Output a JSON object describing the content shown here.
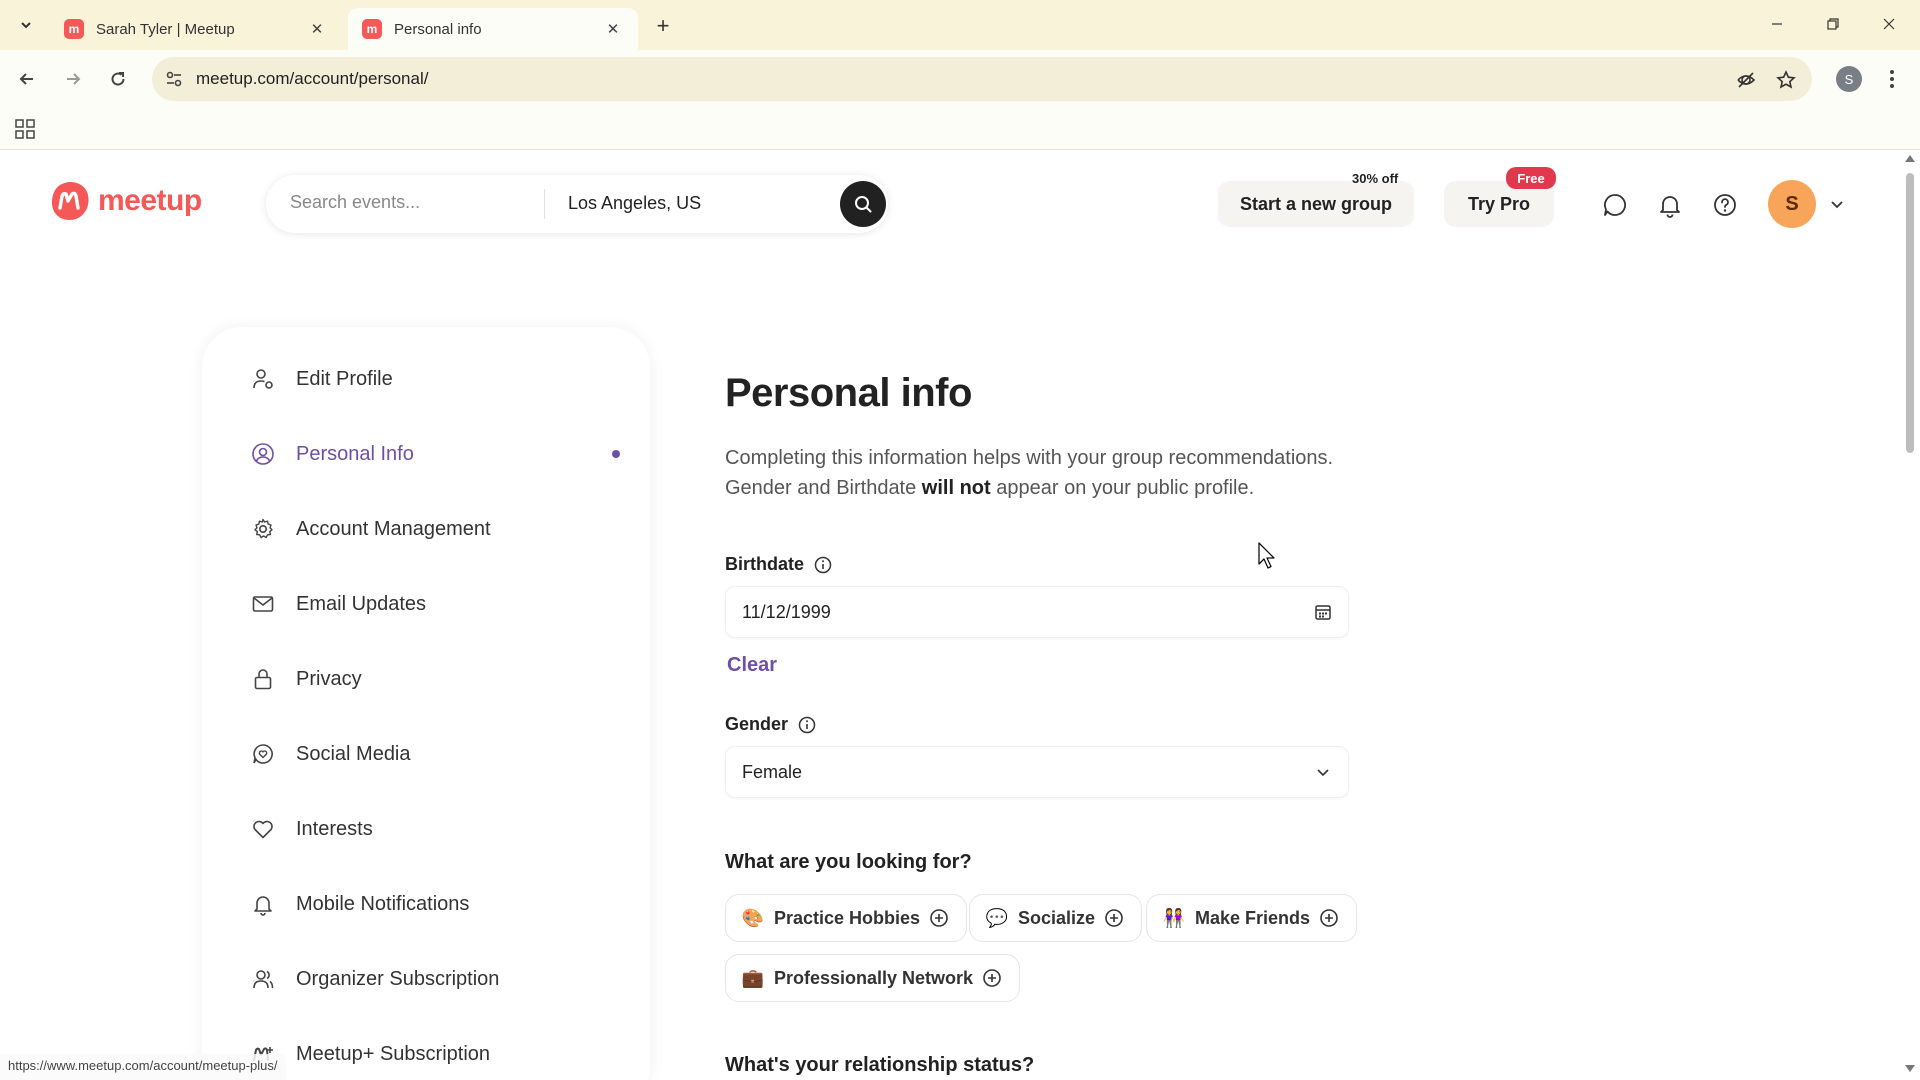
{
  "browser": {
    "tabs": [
      {
        "title": "Sarah Tyler | Meetup",
        "favicon": "m"
      },
      {
        "title": "Personal info",
        "favicon": "m"
      }
    ],
    "url": "meetup.com/account/personal/",
    "profile_initial": "S"
  },
  "header": {
    "logo_text": "meetup",
    "search_placeholder": "Search events...",
    "location": "Los Angeles, US",
    "start_group_label": "Start a new group",
    "start_group_badge": "30% off",
    "try_pro_label": "Try Pro",
    "try_pro_badge": "Free",
    "avatar_initial": "S"
  },
  "sidebar": {
    "items": [
      {
        "label": "Edit Profile",
        "icon": "user-edit-icon"
      },
      {
        "label": "Personal Info",
        "icon": "user-circle-icon",
        "active": true
      },
      {
        "label": "Account Management",
        "icon": "gear-icon"
      },
      {
        "label": "Email Updates",
        "icon": "mail-icon"
      },
      {
        "label": "Privacy",
        "icon": "lock-icon"
      },
      {
        "label": "Social Media",
        "icon": "chat-heart-icon"
      },
      {
        "label": "Interests",
        "icon": "heart-icon"
      },
      {
        "label": "Mobile Notifications",
        "icon": "bell-icon"
      },
      {
        "label": "Organizer Subscription",
        "icon": "organizer-icon"
      },
      {
        "label": "Meetup+ Subscription",
        "icon": "meetup-plus-icon"
      }
    ]
  },
  "main": {
    "title": "Personal info",
    "desc_part1": "Completing this information helps with your group recommendations. Gender and Birthdate ",
    "desc_bold": "will not",
    "desc_part2": " appear on your public profile.",
    "birthdate_label": "Birthdate",
    "birthdate_value": "11/12/1999",
    "clear_label": "Clear",
    "gender_label": "Gender",
    "gender_value": "Female",
    "looking_for_title": "What are you looking for?",
    "looking_for": [
      {
        "label": "Practice Hobbies",
        "emoji": "🎨"
      },
      {
        "label": "Socialize",
        "emoji": "💬"
      },
      {
        "label": "Make Friends",
        "emoji": "👭"
      },
      {
        "label": "Professionally Network",
        "emoji": "💼"
      }
    ],
    "relationship_title": "What's your relationship status?"
  },
  "status_bar_url": "https://www.meetup.com/account/meetup-plus/",
  "colors": {
    "brand": "#f65858",
    "accent": "#6e4fa6",
    "free_badge": "#e0394e",
    "avatar": "#f8a55a",
    "chrome": "#f9f4d9"
  }
}
